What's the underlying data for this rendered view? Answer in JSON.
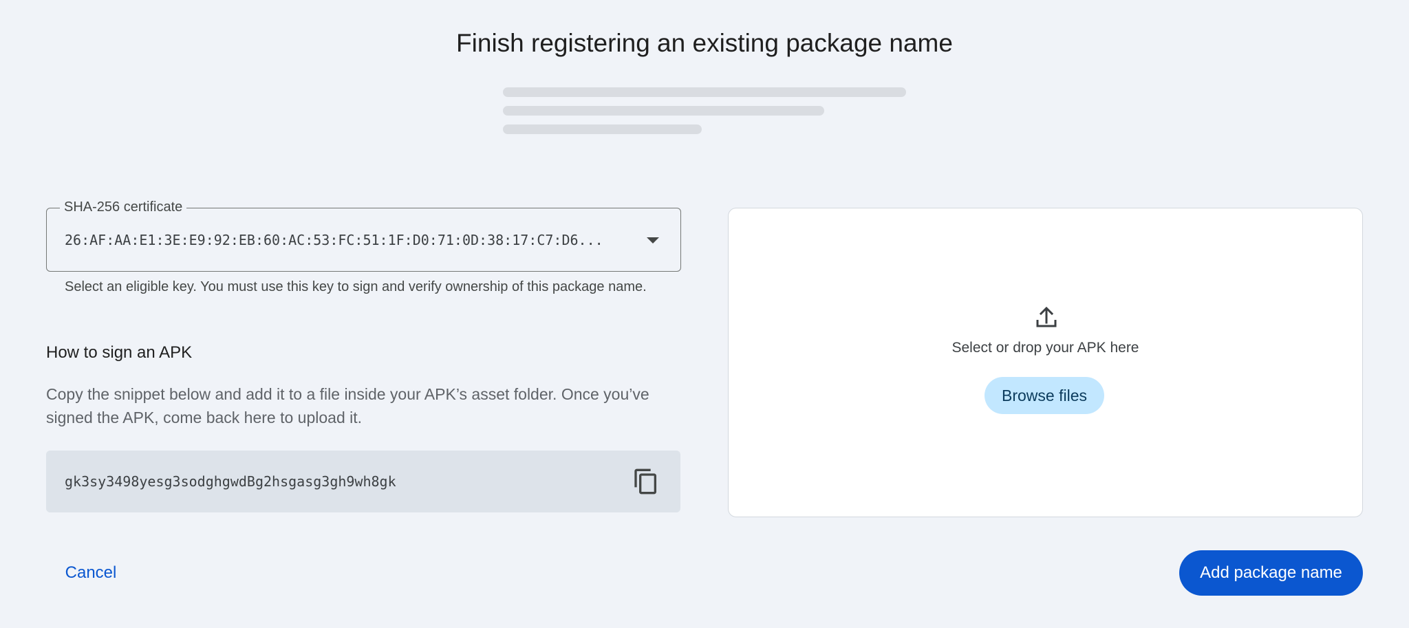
{
  "dialog": {
    "title": "Finish registering an existing package name"
  },
  "certificate": {
    "label": "SHA-256 certificate",
    "value": "26:AF:AA:E1:3E:E9:92:EB:60:AC:53:FC:51:1F:D0:71:0D:38:17:C7:D6...",
    "helper": "Select an eligible key. You must use this key to sign and verify ownership of this package name."
  },
  "sign_section": {
    "heading": "How to sign an APK",
    "description": "Copy the snippet below and add it to a file inside your APK’s asset folder. Once you’ve signed the APK, come back here to upload it.",
    "snippet": "gk3sy3498yesg3sodghgwdBg2hsgasg3gh9wh8gk",
    "copy_icon": "copy-icon"
  },
  "upload": {
    "icon": "upload-icon",
    "prompt": "Select or drop your APK here",
    "browse_label": "Browse files"
  },
  "actions": {
    "cancel_label": "Cancel",
    "submit_label": "Add package name"
  },
  "colors": {
    "primary": "#0b57d0",
    "tonal": "#c2e7ff",
    "background": "#f0f3f8"
  }
}
